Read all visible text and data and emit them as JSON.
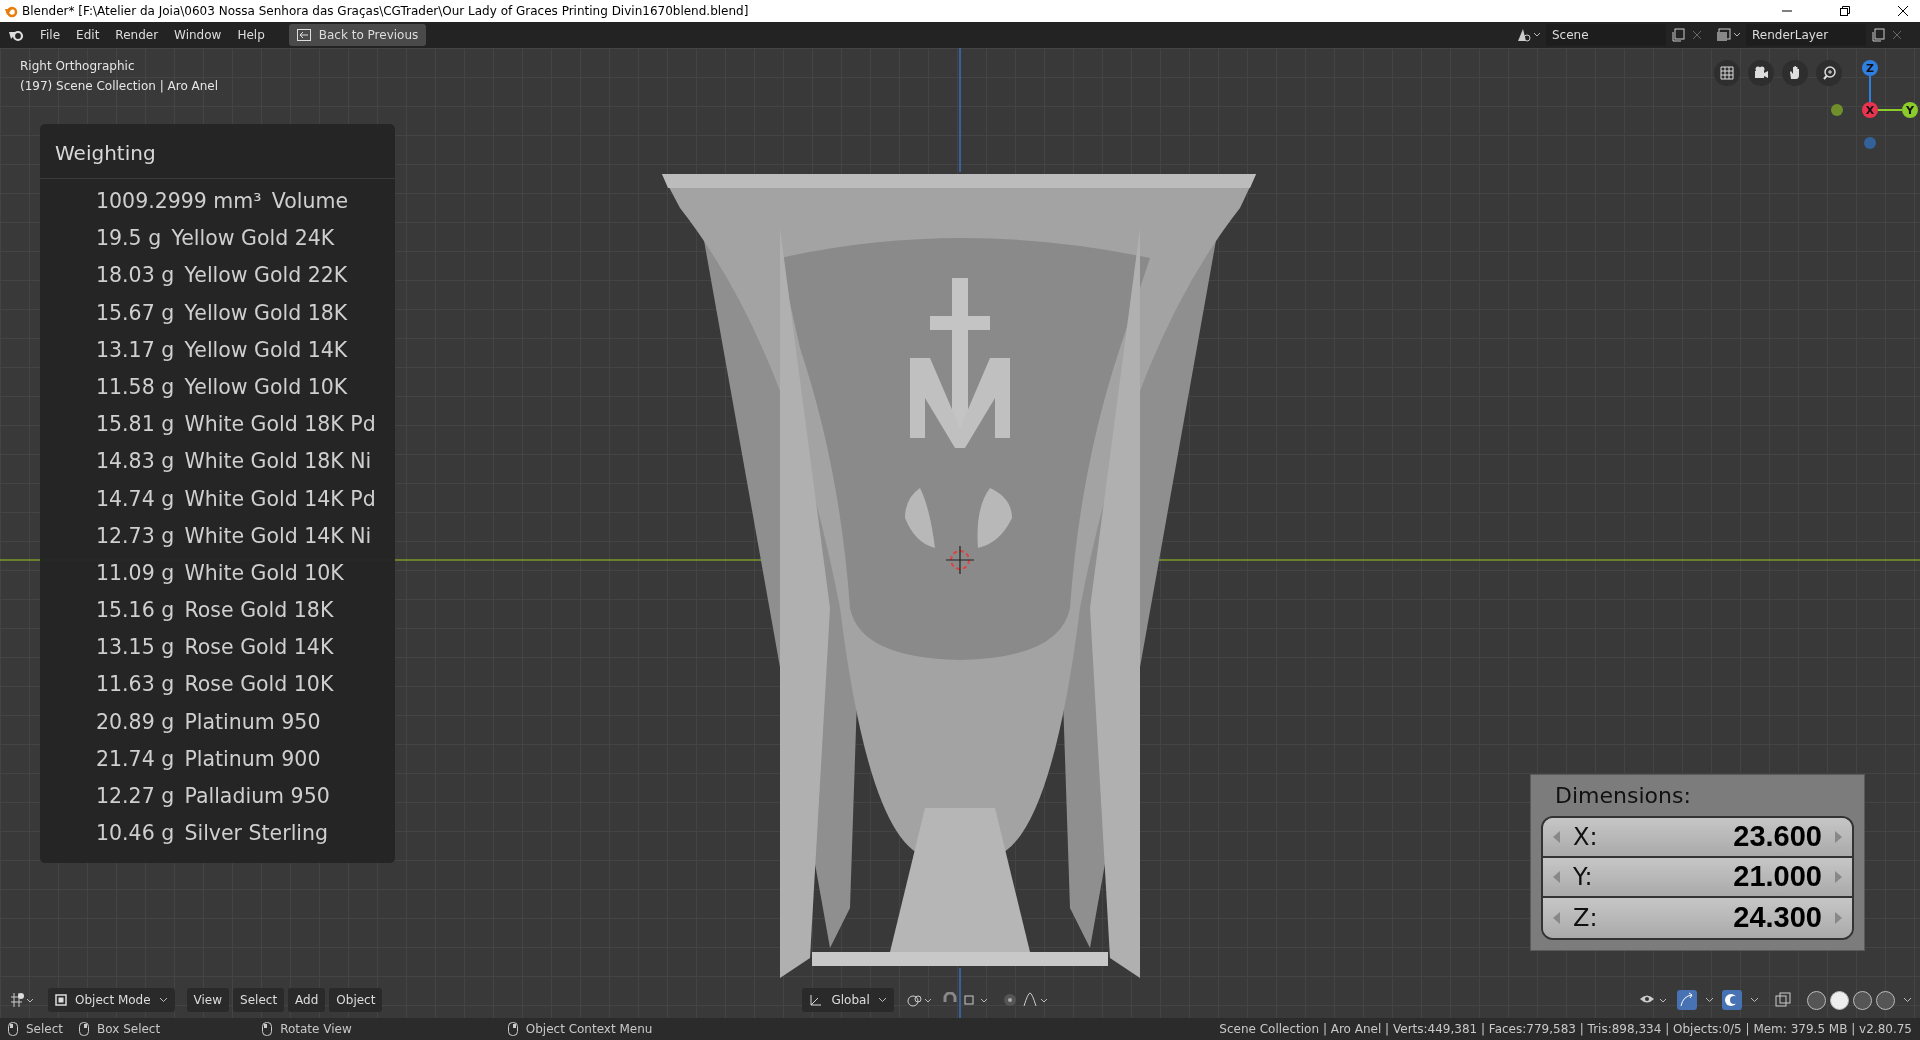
{
  "window": {
    "title": "Blender* [F:\\Atelier da Joia\\0603 Nossa Senhora das Graças\\CGTrader\\Our Lady of Graces Printing Divin1670blend.blend]"
  },
  "top_bar": {
    "menus": [
      "File",
      "Edit",
      "Render",
      "Window",
      "Help"
    ],
    "back_button": "Back to Previous",
    "scene": "Scene",
    "view_layer": "RenderLayer"
  },
  "viewport": {
    "view_name": "Right Orthographic",
    "collection_info": "(197) Scene Collection | Aro Anel",
    "gizmo_axes": [
      {
        "label": "Z",
        "color": "#2f7fe0"
      },
      {
        "label": "X",
        "color": "#e8344f"
      },
      {
        "label": "Y",
        "color": "#8bcb2a"
      }
    ]
  },
  "weighting": {
    "title": "Weighting",
    "rows": [
      {
        "value": "1009.2999 mm³",
        "label": "Volume"
      },
      {
        "value": "19.5 g",
        "label": "Yellow Gold 24K"
      },
      {
        "value": "18.03 g",
        "label": "Yellow Gold 22K"
      },
      {
        "value": "15.67 g",
        "label": "Yellow Gold 18K"
      },
      {
        "value": "13.17 g",
        "label": "Yellow Gold 14K"
      },
      {
        "value": "11.58 g",
        "label": "Yellow Gold 10K"
      },
      {
        "value": "15.81 g",
        "label": "White Gold 18K Pd"
      },
      {
        "value": "14.83 g",
        "label": "White Gold 18K Ni"
      },
      {
        "value": "14.74 g",
        "label": "White Gold 14K Pd"
      },
      {
        "value": "12.73 g",
        "label": "White Gold 14K Ni"
      },
      {
        "value": "11.09 g",
        "label": "White Gold 10K"
      },
      {
        "value": "15.16 g",
        "label": "Rose Gold 18K"
      },
      {
        "value": "13.15 g",
        "label": "Rose Gold 14K"
      },
      {
        "value": "11.63 g",
        "label": "Rose Gold 10K"
      },
      {
        "value": "20.89 g",
        "label": "Platinum 950"
      },
      {
        "value": "21.74 g",
        "label": "Platinum 900"
      },
      {
        "value": "12.27 g",
        "label": "Palladium 950"
      },
      {
        "value": "10.46 g",
        "label": "Silver Sterling"
      }
    ]
  },
  "dimensions": {
    "title": "Dimensions:",
    "fields": [
      {
        "axis": "X:",
        "value": "23.600"
      },
      {
        "axis": "Y:",
        "value": "21.000"
      },
      {
        "axis": "Z:",
        "value": "24.300"
      }
    ]
  },
  "header": {
    "mode": "Object Mode",
    "menus": [
      "View",
      "Select",
      "Add",
      "Object"
    ],
    "orientation": "Global",
    "shading_modes": [
      {
        "selected": false
      },
      {
        "selected": true
      },
      {
        "selected": false
      },
      {
        "selected": false
      }
    ]
  },
  "status_bar": {
    "hints": [
      "Select",
      "Box Select",
      "Rotate View",
      "Object Context Menu"
    ],
    "stats": "Scene Collection | Aro Anel | Verts:449,381 | Faces:779,583 | Tris:898,334 | Objects:0/5 | Mem: 379.5 MB | v2.80.75"
  }
}
